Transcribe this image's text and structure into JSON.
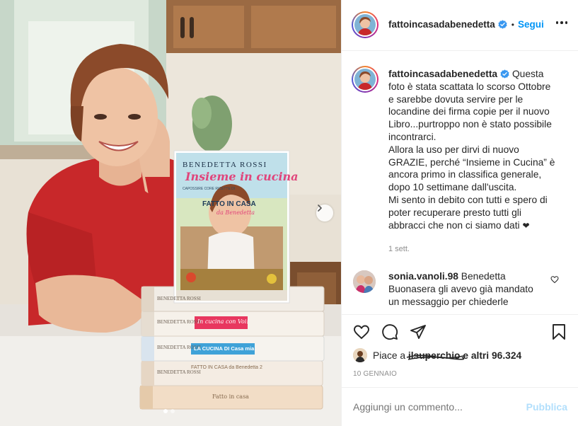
{
  "post": {
    "author": "fattoincasadabenedetta",
    "follow_label": "Segui",
    "caption_lines": [
      "Questa",
      "foto è stata scattata lo scorso Ottobre",
      "e sarebbe dovuta servire per le",
      "locandine dei firma copie per il nuovo",
      "Libro...purtroppo non è stato possibile",
      "incontrarci.",
      "Allora la uso per dirvi di nuovo",
      "GRAZIE, perché “Insieme in Cucina” è",
      "ancora primo in classifica generale,",
      "dopo 10 settimane dall'uscita.",
      "Mi sento in debito con tutti e spero di",
      "poter recuperare presto tutti gli",
      "abbracci che non ci siamo dati"
    ],
    "caption_time": "1 sett.",
    "likes_prefix": "Piace a",
    "likes_user": "ilsuperchio",
    "likes_suffix": "e altri 96.324",
    "date": "10 GENNAIO",
    "comment_placeholder": "Aggiungi un commento...",
    "publish_label": "Pubblica",
    "carousel": {
      "count": 2,
      "active": 1
    }
  },
  "comments": [
    {
      "user": "sonia.vanoli.98",
      "lines": [
        "Benedetta",
        "Buonasera gli avevo già mandato",
        "un messaggio per chiederle",
        "..."
      ]
    }
  ],
  "book": {
    "author": "BENEDETTA ROSSI",
    "title": "Insieme in cucina",
    "subtitle": "FATTO IN CASA",
    "subtitle2": "da Benedetta",
    "tagline": "CAPOSSIRE CORE RICETTE DI",
    "spines": [
      {
        "author": "BENEDETTA ROSSI",
        "title": "In cucina con Voi!"
      },
      {
        "author": "BENEDETTA ROSSI",
        "title": "LA CUCINA DI Casa mia"
      },
      {
        "author": "BENEDETTA ROSSI",
        "title": "FATTO IN CASA da Benedetta 2"
      },
      {
        "author": "BENEDETTA ROSSI",
        "title": "Fatto in casa"
      }
    ]
  },
  "colors": {
    "accent": "#0095f6",
    "publish_disabled": "#b2dffc",
    "verified": "#3897f0",
    "muted": "#8e8e8e"
  },
  "icons": [
    "verified-badge-icon",
    "more-options-icon",
    "heart-icon",
    "comment-icon",
    "share-icon",
    "bookmark-icon",
    "chevron-right-icon"
  ]
}
